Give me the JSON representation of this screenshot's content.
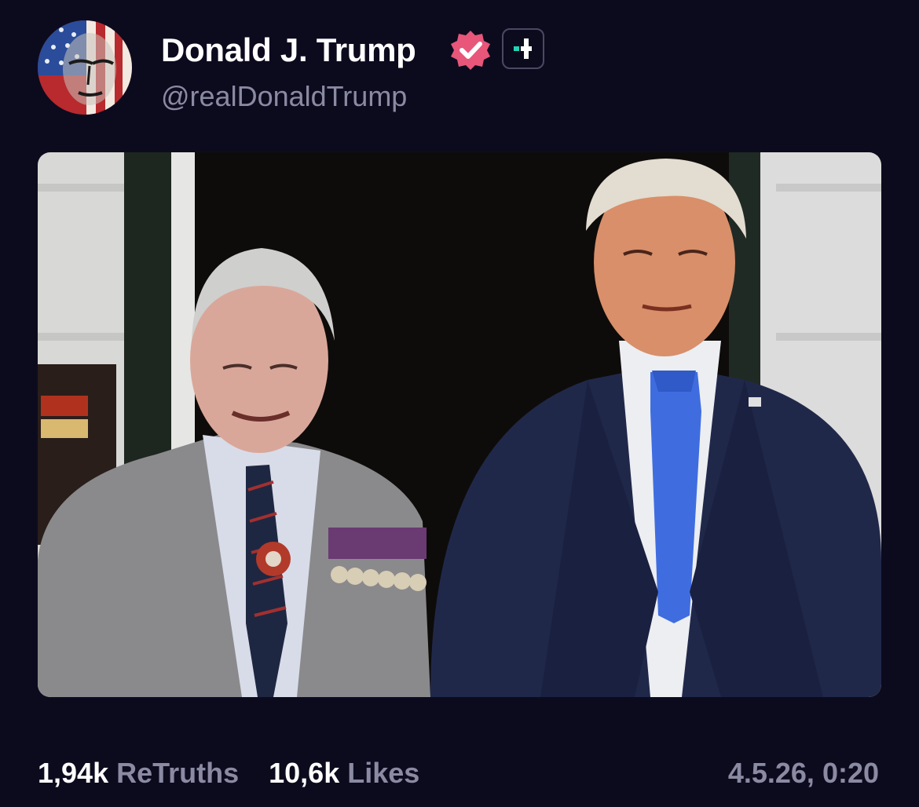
{
  "post": {
    "author": {
      "display_name": "Donald J. Trump",
      "handle": "@realDonaldTrump",
      "verified_color": "#e8567a",
      "avatar_icon": "flag-face-avatar"
    },
    "follow_icon": "plus-icon",
    "accent_color": "#22d3b6",
    "stats": {
      "retruths_count": "1,94k",
      "retruths_label": "ReTruths",
      "likes_count": "10,6k",
      "likes_label": "Likes"
    },
    "timestamp": "4.5.26, 0:20"
  },
  "colors": {
    "background": "#0c0b1e",
    "muted_text": "#8b8aa3",
    "primary_text": "#ffffff"
  }
}
